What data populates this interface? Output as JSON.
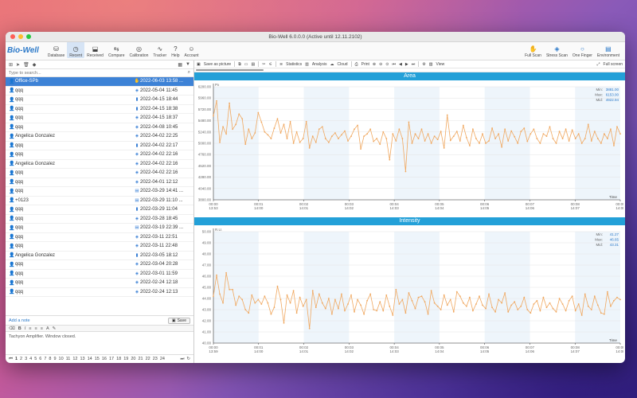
{
  "window": {
    "title": "Bio-Well 6.0.0.0 (Active until 12.11.2102)"
  },
  "app": {
    "logo": "Bio-Well"
  },
  "toolbar": {
    "left": [
      {
        "label": "Database",
        "icon": "database-icon",
        "active": false
      },
      {
        "label": "Recent",
        "icon": "recent-icon",
        "active": true
      },
      {
        "label": "Received",
        "icon": "inbox-icon",
        "active": false
      },
      {
        "label": "Compare",
        "icon": "compare-icon",
        "active": false
      },
      {
        "label": "Calibration",
        "icon": "calibration-icon",
        "active": false
      },
      {
        "label": "Tracker",
        "icon": "tracker-icon",
        "active": false
      },
      {
        "label": "Help",
        "icon": "help-icon",
        "active": false
      },
      {
        "label": "Account",
        "icon": "account-icon",
        "active": false
      }
    ],
    "right": [
      {
        "label": "Full Scan",
        "icon": "full-scan-icon"
      },
      {
        "label": "Stress Scan",
        "icon": "stress-scan-icon"
      },
      {
        "label": "One Finger",
        "icon": "one-finger-icon"
      },
      {
        "label": "Environment",
        "icon": "environment-icon"
      }
    ]
  },
  "search": {
    "placeholder": "Type to search..."
  },
  "records": [
    {
      "name": "Office-SPb",
      "date": "2022-06-03 13:58 ...",
      "type": "full",
      "selected": true
    },
    {
      "name": "qqq",
      "date": "2022-05-04 11:45",
      "type": "stress"
    },
    {
      "name": "qqq",
      "date": "2022-04-15 18:44",
      "type": "finger"
    },
    {
      "name": "qqq",
      "date": "2022-04-15 18:38",
      "type": "finger"
    },
    {
      "name": "qqq",
      "date": "2022-04-15 18:37",
      "type": "stress"
    },
    {
      "name": "qqq",
      "date": "2022-04-08 10:45",
      "type": "stress"
    },
    {
      "name": "Angelica Gonzalez",
      "date": "2022-04-02 22:25",
      "type": "stress"
    },
    {
      "name": "qqq",
      "date": "2022-04-02 22:17",
      "type": "finger"
    },
    {
      "name": "qqq",
      "date": "2022-04-02 22:16",
      "type": "stress"
    },
    {
      "name": "Angelica Gonzalez",
      "date": "2022-04-02 22:16",
      "type": "stress"
    },
    {
      "name": "qqq",
      "date": "2022-04-02 22:16",
      "type": "stress"
    },
    {
      "name": "qqq",
      "date": "2022-04-01 12:12",
      "type": "stress"
    },
    {
      "name": "qqq",
      "date": "2022-03-29 14:41 ...",
      "type": "env"
    },
    {
      "name": "+0123",
      "date": "2022-03-29 11:10 ...",
      "type": "env"
    },
    {
      "name": "qqq",
      "date": "2022-03-29 11:04",
      "type": "finger"
    },
    {
      "name": "qqq",
      "date": "2022-03-28 18:45",
      "type": "stress"
    },
    {
      "name": "qqq",
      "date": "2022-03-19 22:39 ...",
      "type": "env"
    },
    {
      "name": "qqq",
      "date": "2022-03-11 22:51",
      "type": "stress"
    },
    {
      "name": "qqq",
      "date": "2022-03-11 22:48",
      "type": "stress"
    },
    {
      "name": "Angelica Gonzalez",
      "date": "2022-03-05 18:12",
      "type": "finger"
    },
    {
      "name": "qqq",
      "date": "2022-03-04 20:28",
      "type": "stress"
    },
    {
      "name": "qqq",
      "date": "2022-03-01 11:59",
      "type": "stress"
    },
    {
      "name": "qqq",
      "date": "2022-02-24 12:18",
      "type": "stress"
    },
    {
      "name": "qqq",
      "date": "2022-02-24 12:13",
      "type": "stress"
    }
  ],
  "notes": {
    "add_label": "Add a note",
    "save_label": "Save",
    "text": "Tachyon Amplifier. Window closed."
  },
  "pager": {
    "pages": [
      "1",
      "2",
      "3",
      "4",
      "5",
      "6",
      "7",
      "8",
      "9",
      "10",
      "11",
      "12",
      "13",
      "14",
      "15",
      "16",
      "17",
      "18",
      "19",
      "20",
      "21",
      "22",
      "23",
      "24"
    ],
    "current": "1"
  },
  "chart_toolbar": {
    "save": "Save as picture",
    "statistics": "Statistics",
    "analysis": "Analysis",
    "cloud": "Cloud",
    "print": "Print",
    "view": "View",
    "fullscreen": "Full screen"
  },
  "chart_data": [
    {
      "type": "line",
      "title": "Area",
      "unit": "Px",
      "ylim": [
        3800,
        6200
      ],
      "yticks": [
        "6200.00",
        "5960.00",
        "5720.00",
        "5480.00",
        "5240.00",
        "5000.00",
        "4760.00",
        "4520.00",
        "4280.00",
        "4040.00",
        "3800.00"
      ],
      "xticks": [
        [
          "00:00",
          "13:53"
        ],
        [
          "00:01",
          "14:00"
        ],
        [
          "00:02",
          "14:01"
        ],
        [
          "00:03",
          "14:02"
        ],
        [
          "00:04",
          "14:03"
        ],
        [
          "00:05",
          "14:04"
        ],
        [
          "00:06",
          "14:05"
        ],
        [
          "00:07",
          "14:06"
        ],
        [
          "00:08",
          "14:07"
        ],
        [
          "00:09",
          "14:08"
        ]
      ],
      "xlabel": "Time",
      "stats": {
        "min_label": "Min:",
        "min": "3881.00",
        "max_label": "Max:",
        "max": "6153.00",
        "mid_label": "Mid:",
        "mid": "4922.94"
      },
      "color": "#f0a860",
      "values": [
        5580,
        5900,
        5020,
        5350,
        5200,
        5850,
        5300,
        5400,
        5620,
        5520,
        4980,
        5300,
        5100,
        5220,
        5650,
        5450,
        5240,
        5180,
        5100,
        5320,
        5520,
        5220,
        5400,
        5100,
        5460,
        5000,
        5240,
        5020,
        5100,
        5460,
        4900,
        5150,
        5020,
        5300,
        5350,
        5100,
        5020,
        5150,
        5220,
        5100,
        5180,
        5260,
        5050,
        5150,
        5300,
        5380,
        4880,
        5150,
        5200,
        5300,
        5040,
        5100,
        4980,
        5240,
        5100,
        4650,
        5200,
        5050,
        5300,
        5100,
        4400,
        5450,
        5000,
        5200,
        5100,
        5300,
        5050,
        5200,
        5000,
        5150,
        5080,
        5250,
        4900,
        5600,
        5060,
        5150,
        5250,
        5050,
        5380,
        5120,
        4950,
        5300,
        5100,
        5000,
        5200,
        5000,
        5050,
        5320,
        5100,
        5200,
        4920,
        5300,
        5050,
        5260,
        5140,
        5000,
        5250,
        5320,
        5040,
        5200,
        5300,
        5100,
        5000,
        5200,
        5150,
        5350,
        5100,
        5000,
        5250,
        5100,
        5300,
        5050,
        5280,
        5100,
        5200,
        5000,
        5100,
        5400,
        5050,
        5250,
        5100,
        5000,
        5200,
        5100,
        5300,
        4950,
        5350,
        5200
      ]
    },
    {
      "type": "line",
      "title": "Intensity",
      "unit": "R.U.",
      "ylim": [
        40,
        50
      ],
      "yticks": [
        "50.00",
        "49.00",
        "48.00",
        "47.00",
        "46.00",
        "45.00",
        "44.00",
        "43.00",
        "42.00",
        "41.00",
        "40.00"
      ],
      "xticks": [
        [
          "00:00",
          "13:59"
        ],
        [
          "00:01",
          "14:00"
        ],
        [
          "00:02",
          "14:01"
        ],
        [
          "00:03",
          "14:02"
        ],
        [
          "00:04",
          "14:03"
        ],
        [
          "00:05",
          "14:04"
        ],
        [
          "00:06",
          "14:05"
        ],
        [
          "00:07",
          "14:06"
        ],
        [
          "00:08",
          "14:07"
        ],
        [
          "00:09",
          "14:08"
        ]
      ],
      "xlabel": "Time",
      "stats": {
        "min_label": "Min:",
        "min": "41.27",
        "max_label": "Max:",
        "max": "46.65",
        "mid_label": "Mid:",
        "mid": "43.31"
      },
      "color": "#f0a860",
      "values": [
        44.2,
        46.1,
        44.4,
        43.6,
        46.3,
        44.8,
        44.8,
        43.4,
        44.2,
        43.9,
        43.0,
        42.7,
        44.3,
        43.6,
        43.9,
        43.5,
        44.2,
        43.6,
        42.6,
        43.2,
        45.1,
        43.9,
        41.8,
        44.3,
        43.6,
        44.7,
        42.7,
        44.1,
        43.3,
        43.9,
        41.3,
        44.7,
        43.2,
        44.4,
        43.6,
        43.1,
        44.0,
        42.6,
        43.9,
        43.1,
        44.4,
        42.9,
        43.5,
        44.3,
        42.8,
        43.9,
        43.4,
        42.6,
        43.8,
        44.4,
        43.0,
        42.9,
        43.7,
        42.9,
        44.3,
        43.3,
        42.5,
        44.8,
        43.5,
        43.9,
        42.7,
        44.5,
        43.8,
        43.1,
        44.1,
        44.2,
        43.7,
        42.6,
        44.7,
        43.6,
        43.3,
        43.0,
        44.3,
        43.4,
        43.9,
        42.8,
        44.6,
        44.2,
        43.6,
        43.3,
        44.1,
        42.9,
        43.5,
        44.2,
        43.4,
        43.1,
        44.4,
        43.2,
        42.8,
        43.9,
        43.6,
        44.5,
        42.8,
        43.4,
        43.7,
        43.0,
        43.3,
        44.1,
        43.0,
        42.7,
        43.5,
        43.8,
        42.9,
        44.1,
        43.2,
        43.6,
        43.1,
        42.8,
        44.0,
        43.5,
        42.9,
        43.8,
        44.2,
        42.9,
        43.5,
        42.5,
        44.4,
        43.3,
        43.0,
        44.2,
        43.4,
        42.7,
        42.6,
        44.6,
        43.3,
        43.8,
        44.1,
        43.9
      ]
    }
  ]
}
